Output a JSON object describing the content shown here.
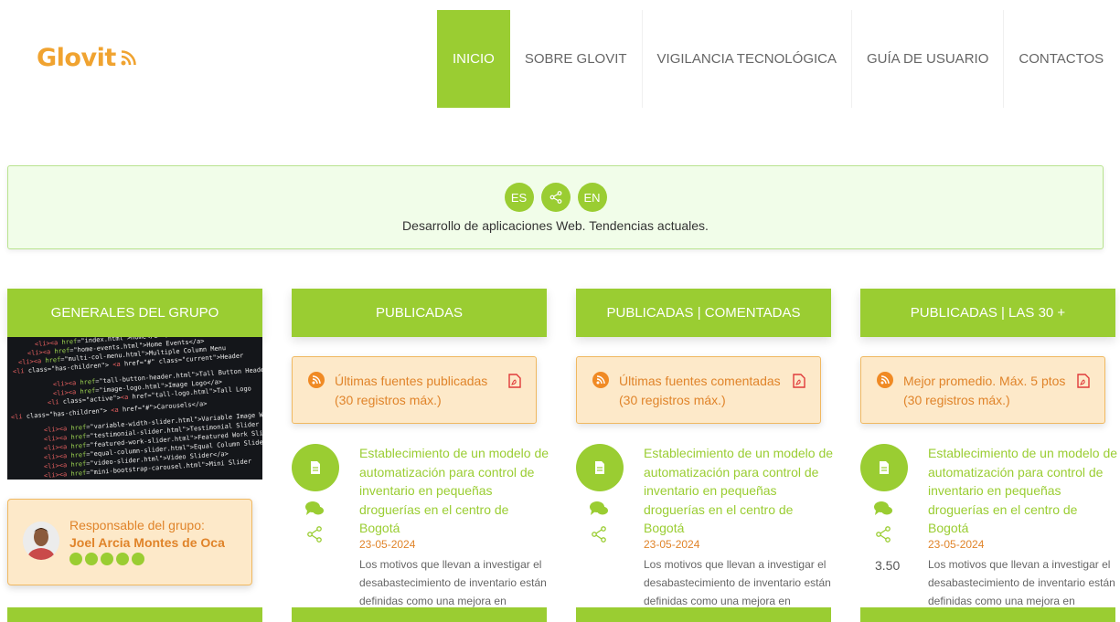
{
  "header": {
    "logo_text": "Glovit",
    "nav": [
      {
        "label": "INICIO",
        "active": true
      },
      {
        "label": "SOBRE GLOVIT",
        "active": false
      },
      {
        "label": "VIGILANCIA TECNOLÓGICA",
        "active": false
      },
      {
        "label": "GUÍA DE USUARIO",
        "active": false
      },
      {
        "label": "CONTACTOS",
        "active": false
      }
    ]
  },
  "banner": {
    "lang_es": "ES",
    "lang_en": "EN",
    "subtitle": "Desarrollo de aplicaciones Web. Tendencias actuales."
  },
  "group": {
    "heading": "GENERALES DEL GRUPO",
    "responsible_label": "Responsable del grupo:",
    "responsible_name": "Joel Arcia Montes de Oca"
  },
  "columns": [
    {
      "heading": "PUBLICADAS",
      "source_title": "Últimas fuentes publicadas",
      "source_sub": "(30 registros máx.)",
      "item_title": "Establecimiento de un modelo de automatización para control de inventario en pequeñas droguerías en el centro de Bogotá",
      "item_date": "23-05-2024",
      "item_desc": "Los motivos que llevan a investigar el desabastecimiento de inventario están definidas como una mejora en",
      "rating": ""
    },
    {
      "heading": "PUBLICADAS | COMENTADAS",
      "source_title": "Últimas fuentes comentadas",
      "source_sub": "(30 registros máx.)",
      "item_title": "Establecimiento de un modelo de automatización para control de inventario en pequeñas droguerías en el centro de Bogotá",
      "item_date": "23-05-2024",
      "item_desc": "Los motivos que llevan a investigar el desabastecimiento de inventario están definidas como una mejora en",
      "rating": ""
    },
    {
      "heading": "PUBLICADAS | LAS 30 +",
      "source_title": "Mejor promedio. Máx. 5 ptos",
      "source_sub": "(30 registros máx.)",
      "item_title": "Establecimiento de un modelo de automatización para control de inventario en pequeñas droguerías en el centro de Bogotá",
      "item_date": "23-05-2024",
      "item_desc": "Los motivos que llevan a investigar el desabastecimiento de inventario están definidas como una mejora en",
      "rating": "3.50"
    }
  ],
  "colors": {
    "accent": "#9acd32",
    "orange": "#e0842a",
    "box_bg": "#fde9c9"
  }
}
